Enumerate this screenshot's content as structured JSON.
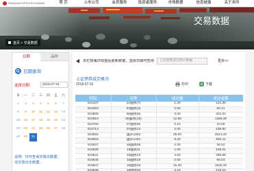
{
  "header": {
    "logo_text": "SHANGHAI STOCK EXCHANGE",
    "nav": [
      "首 页",
      "上市公司",
      "会员服务",
      "投资者服务",
      "市场数据",
      "信息披露",
      "关于本所"
    ]
  },
  "banner": {
    "title": "交易数据",
    "breadcrumb": "首页 > 交易数据",
    "breadcrumb_icon": "home-icon"
  },
  "sidebar": {
    "tabs": [
      {
        "label": "日期",
        "active": true
      },
      {
        "label": "品种",
        "active": false
      }
    ],
    "search_icon": "search-icon",
    "search_title": "日期查询",
    "date_label": "选择日期:",
    "date_value": "2018-07-31",
    "calendar": {
      "weekdays": [
        "日",
        "一",
        "二",
        "三",
        "四",
        "五",
        "六"
      ],
      "weeks": [
        [
          "1",
          "2",
          "3",
          "4",
          "5",
          "6",
          "7"
        ],
        [
          "8",
          "9",
          "10",
          "11",
          "12",
          "13",
          "14"
        ],
        [
          "15",
          "16",
          "17",
          "18",
          "19",
          "20",
          "21"
        ],
        [
          "22",
          "23",
          "24",
          "25",
          "26",
          "27",
          "28"
        ],
        [
          "29",
          "30",
          "31",
          "",
          "",
          "",
          ""
        ]
      ],
      "selected_day": 31
    },
    "note_lines": [
      "说明：仅可查询交易日数据，",
      "非交易日无数据。"
    ]
  },
  "main": {
    "arrow_icon": "arrow-left-icon",
    "info_text": "本栏目每日收盘后更新数据，选择日期可查询",
    "filter_box_text": "上证债券成交统计数据",
    "more_link": "更多>>",
    "title": "上证债券成交概况",
    "date": "2018-07-31",
    "actions": [
      {
        "label": "打印",
        "icon": "printer-icon"
      },
      {
        "label": "下载",
        "icon": "download-icon"
      }
    ],
    "table": {
      "columns": [
        "代码",
        "名称",
        "成交量",
        "成交金额"
      ],
      "rows": [
        [
          "010107",
          "21国债(7)",
          "1.20",
          "121.35"
        ],
        [
          "010303",
          "03国债(3)",
          "0.50",
          "50.21"
        ],
        [
          "010609",
          "06国债(9)",
          "3.00",
          "301.02"
        ],
        [
          "010619",
          "06国债(19)",
          "12.50",
          "1256.30"
        ],
        [
          "010706",
          "07国债06",
          "0.10",
          "10.05"
        ],
        [
          "010713",
          "07国债13",
          "2.00",
          "198.60"
        ],
        [
          "018002",
          "国开1302",
          "25.00",
          "2513.40"
        ],
        [
          "018003",
          "国开1401",
          "8.20",
          "830.11"
        ],
        [
          "019537",
          "16国债09",
          "0.30",
          "30.02"
        ],
        [
          "019539",
          "16国债11",
          "1.00",
          "100.01"
        ],
        [
          "019541",
          "16国债13",
          "4.00",
          "399.88"
        ],
        [
          "019546",
          "16国债18",
          "0.60",
          "60.03"
        ],
        [
          "019547",
          "16国债19",
          "15.30",
          "1530.20"
        ],
        [
          "019548",
          "16国债20",
          "2.10",
          "210.12"
        ]
      ]
    }
  },
  "colors": {
    "accent_blue": "#2b73c2",
    "table_header": "#8cc2e8",
    "label_red": "#d0282e",
    "calendar_orange": "#e8870e",
    "logo_red": "#c8262c"
  }
}
